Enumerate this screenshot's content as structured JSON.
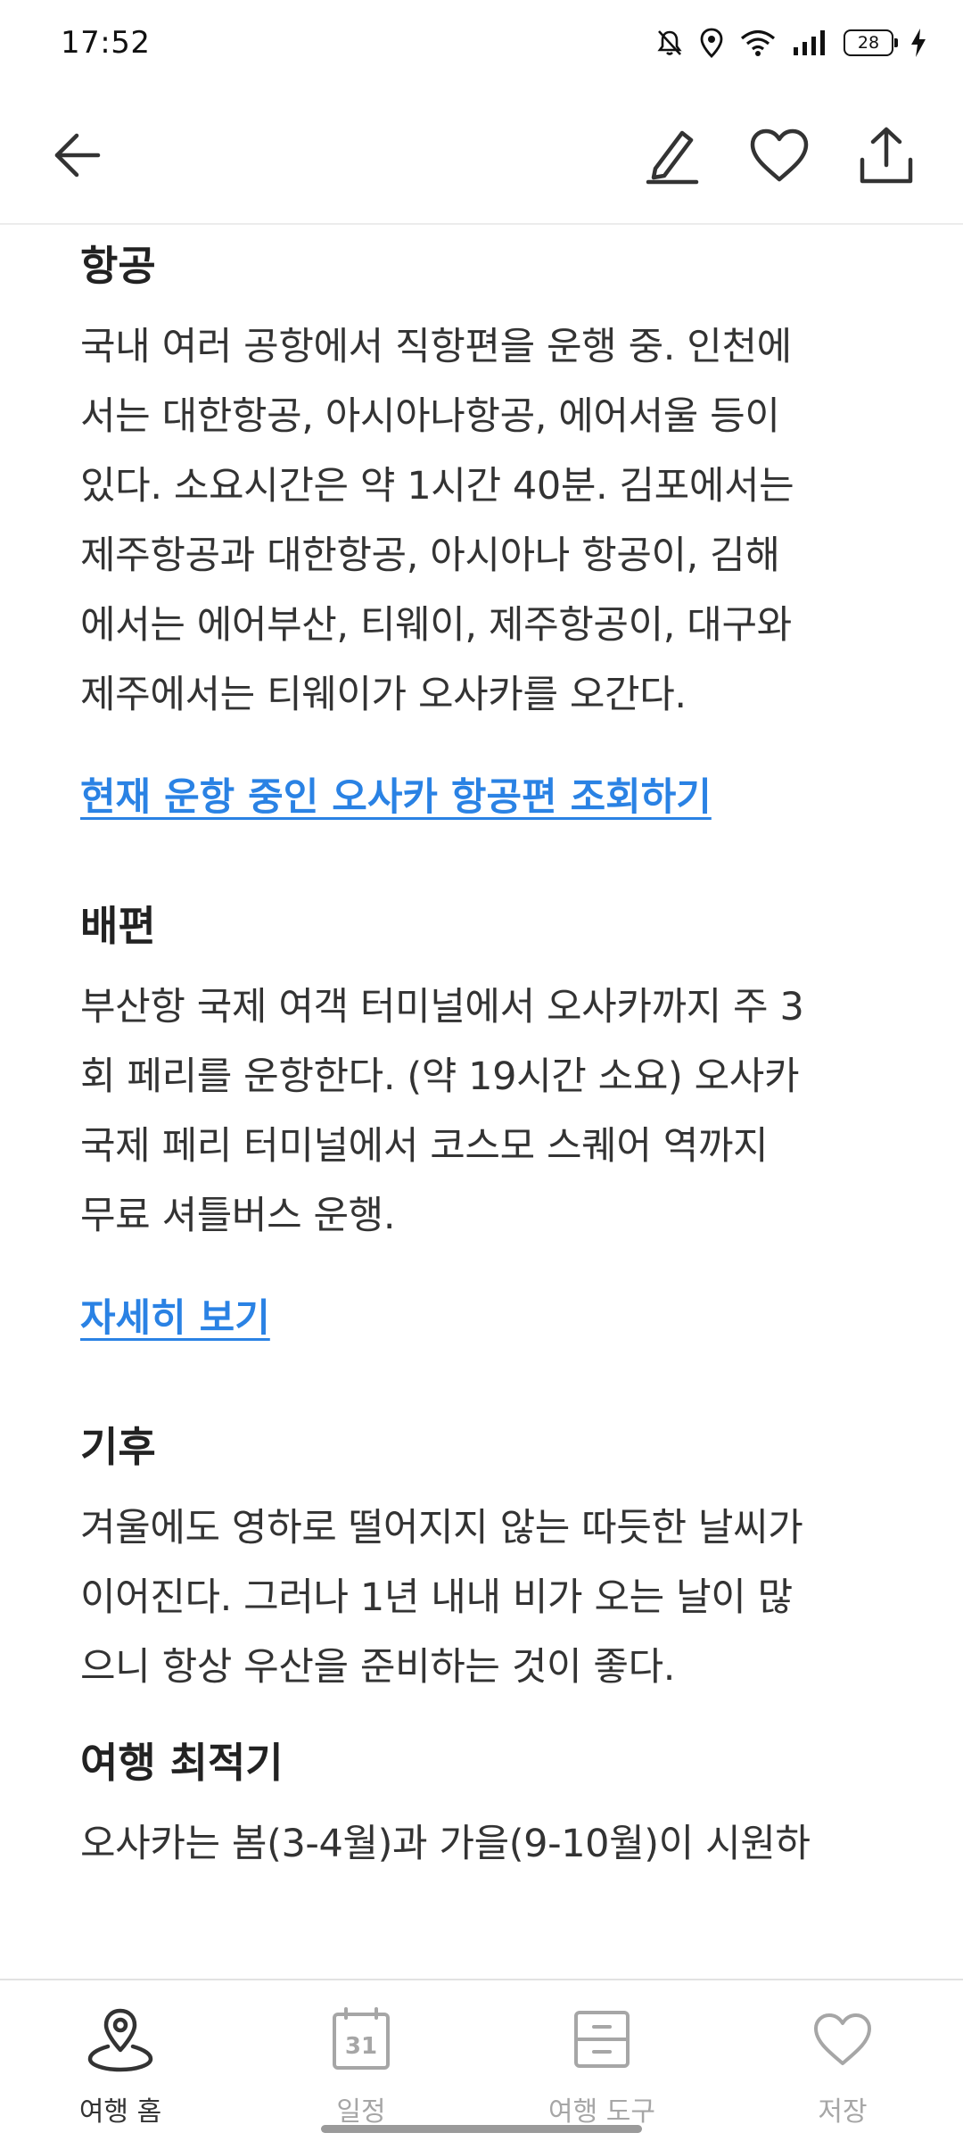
{
  "status_bar": {
    "time": "17:52",
    "battery": "28",
    "icons": [
      "mute-bell-icon",
      "location-icon",
      "wifi-icon",
      "signal-icon",
      "battery-icon",
      "charging-icon"
    ]
  },
  "app_bar": {
    "icons": [
      "back-arrow-icon",
      "pencil-icon",
      "heart-icon",
      "share-icon"
    ]
  },
  "sections": {
    "air": {
      "title": "항공",
      "lines": [
        "국내 여러 공항에서 직항편을 운행 중. 인천에",
        "서는 대한항공, 아시아나항공, 에어서울 등이",
        "있다. 소요시간은 약 1시간 40분. 김포에서는",
        "제주항공과 대한항공, 아시아나 항공이, 김해",
        "에서는 에어부산, 티웨이, 제주항공이, 대구와",
        "제주에서는 티웨이가 오사카를 오간다."
      ],
      "link": "현재 운항 중인 오사카 항공편 조회하기"
    },
    "ship": {
      "title": "배편",
      "lines": [
        "부산항 국제 여객 터미널에서 오사카까지 주 3",
        "회 페리를 운항한다. (약 19시간 소요) 오사카",
        "국제 페리 터미널에서 코스모 스퀘어 역까지",
        "무료 셔틀버스 운행."
      ],
      "link": "자세히 보기"
    },
    "climate": {
      "title": "기후",
      "lines": [
        "겨울에도 영하로 떨어지지 않는 따듯한 날씨가",
        "이어진다. 그러나 1년 내내 비가 오는 날이 많",
        "으니 항상 우산을 준비하는 것이 좋다."
      ]
    },
    "best_time": {
      "title": "여행 최적기",
      "lines": [
        "오사카는 봄(3-4월)과 가을(9-10월)이 시원하"
      ]
    }
  },
  "bottom_nav": {
    "items": [
      {
        "label": "여행 홈",
        "icon": "map-pin-icon",
        "active": true
      },
      {
        "label": "일정",
        "icon": "calendar-icon",
        "calendar_day": "31",
        "active": false
      },
      {
        "label": "여행 도구",
        "icon": "toolbox-icon",
        "active": false
      },
      {
        "label": "저장",
        "icon": "heart-icon",
        "active": false
      }
    ]
  },
  "colors": {
    "link": "#2a82e4",
    "text": "#333333",
    "inactive": "#a6a6a6"
  }
}
